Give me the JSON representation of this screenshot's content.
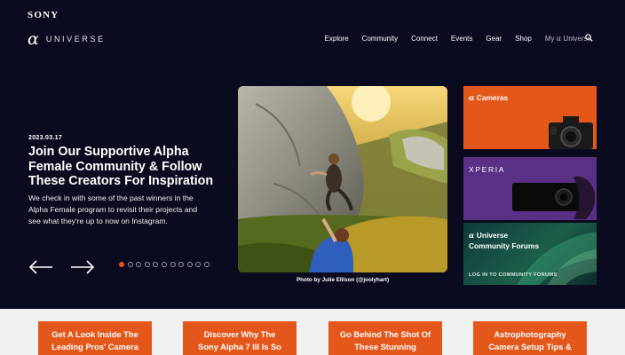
{
  "header": {
    "sony_logo": "SONY",
    "alpha_glyph": "α",
    "universe_wordmark": "UNIVERSE",
    "nav": [
      {
        "label": "Explore"
      },
      {
        "label": "Community"
      },
      {
        "label": "Connect"
      },
      {
        "label": "Events"
      },
      {
        "label": "Gear"
      },
      {
        "label": "Shop"
      }
    ],
    "my_universe": {
      "prefix": "My",
      "alpha": "α",
      "suffix": "Universe"
    },
    "search_icon": "search-icon"
  },
  "hero": {
    "date": "2023.03.17",
    "title": "Join Our Supportive Alpha Female Community & Follow These Creators For Inspiration",
    "description": "We check in with some of the past winners in the Alpha Female program to revisit their projects and see what they're up to now on Instagram.",
    "photo_credit": "Photo by Julie Ellison (@joolyhart)",
    "prev_icon": "arrow-left-icon",
    "next_icon": "arrow-right-icon",
    "slides_total": 11,
    "active_slide": 1
  },
  "side_cards": {
    "cameras": {
      "alpha": "α",
      "label": "Cameras"
    },
    "xperia": {
      "label": "XPERIA"
    },
    "forums": {
      "alpha": "α",
      "line1": "Universe",
      "line2": "Community Forums",
      "cta": "LOG IN TO COMMUNITY FORUMS"
    }
  },
  "tiles": [
    {
      "line1": "Get A Look Inside The",
      "line2": "Leading Pros' Camera"
    },
    {
      "line1": "Discover Why The",
      "line2": "Sony Alpha 7 III Is So"
    },
    {
      "line1": "Go Behind The Shot Of",
      "line2": "These Stunning"
    },
    {
      "line1": "Astrophotography",
      "line2": "Camera Setup Tips &"
    }
  ],
  "colors": {
    "background": "#0b0b1f",
    "accent": "#e4571b",
    "xperia": "#5a2f86",
    "forums": "#1b5e4a",
    "lower_bg": "#f1f1f1"
  }
}
